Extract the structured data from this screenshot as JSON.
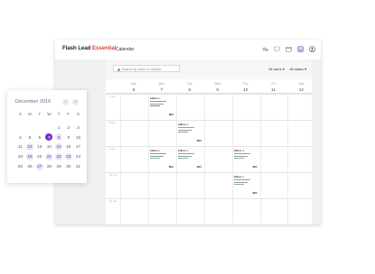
{
  "header": {
    "brand_main": "Flash Lead",
    "brand_accent": "Essential",
    "nav_calendar": "Calendar"
  },
  "toolbar": {
    "search_placeholder": "Search by name or number",
    "filter_users": "All users",
    "filter_statuses": "All status"
  },
  "week": {
    "days": [
      {
        "name": "Sun",
        "num": "6"
      },
      {
        "name": "Mon",
        "num": "7"
      },
      {
        "name": "Tue",
        "num": "8"
      },
      {
        "name": "Wed",
        "num": "9"
      },
      {
        "name": "Thu",
        "num": "10"
      },
      {
        "name": "Fri",
        "num": "11"
      },
      {
        "name": "Sat",
        "num": "12"
      }
    ],
    "time_labels": [
      "7 am",
      "8 am",
      "9 am",
      "10 am",
      "11 am"
    ]
  },
  "events": [
    {
      "title": "Adhoc s.",
      "amount": "$34",
      "col": 1,
      "row": 0,
      "accent": "purple"
    },
    {
      "title": "Adhoc s.",
      "amount": "$34",
      "col": 2,
      "row": 1,
      "accent": "grey"
    },
    {
      "title": "Adhoc s.",
      "amount": "$34",
      "col": 1,
      "row": 2,
      "accent": "green"
    },
    {
      "title": "Adhoc s.",
      "amount": "$34",
      "col": 2,
      "row": 2,
      "accent": "green"
    },
    {
      "title": "Adhoc s.",
      "amount": "$34",
      "col": 4,
      "row": 2,
      "accent": "green"
    },
    {
      "title": "Adhoc s.",
      "amount": "$34",
      "col": 4,
      "row": 3,
      "accent": "green"
    }
  ],
  "mini_calendar": {
    "title": "December 2016",
    "weekdays": [
      "S",
      "M",
      "T",
      "W",
      "T",
      "F",
      "S"
    ],
    "rows": [
      [
        "",
        "",
        "",
        "",
        "1",
        "2",
        "3"
      ],
      [
        "4",
        "5",
        "6",
        "7",
        "8",
        "9",
        "10"
      ],
      [
        "11",
        "12",
        "13",
        "14",
        "15",
        "16",
        "17"
      ],
      [
        "18",
        "19",
        "20",
        "21",
        "22",
        "23",
        "24"
      ],
      [
        "25",
        "26",
        "27",
        "28",
        "29",
        "30",
        "31"
      ]
    ],
    "selected": "7",
    "highlighted": [
      "8",
      "12",
      "15",
      "19",
      "21",
      "22",
      "23",
      "27"
    ],
    "accent_color": "#7a2ad0"
  }
}
